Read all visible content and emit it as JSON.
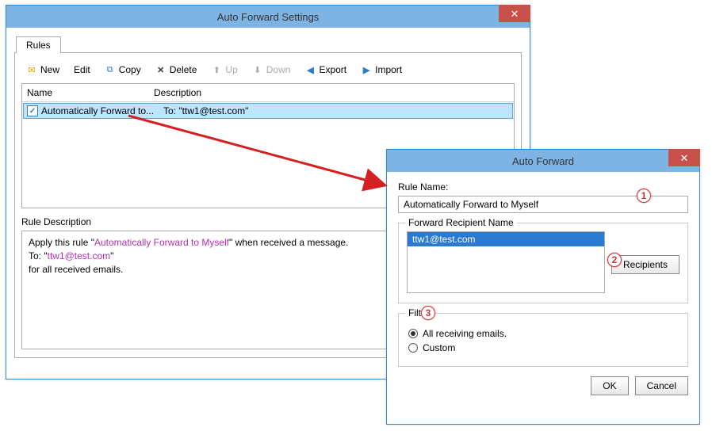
{
  "colors": {
    "accent": "#7eb4e3",
    "close": "#c8504b",
    "selection": "#bfe4ff",
    "highlight": "#2a7ad1",
    "link": "#b030b0"
  },
  "win1": {
    "title": "Auto Forward Settings",
    "tab": "Rules",
    "toolbar": {
      "new": "New",
      "edit": "Edit",
      "copy": "Copy",
      "delete": "Delete",
      "up": "Up",
      "down": "Down",
      "export": "Export",
      "import": "Import"
    },
    "cols": {
      "name": "Name",
      "desc": "Description"
    },
    "rule": {
      "name": "Automatically Forward to...",
      "desc": "To: \"ttw1@test.com\""
    },
    "descLabel": "Rule Description",
    "descText": {
      "l1a": "Apply this rule \"",
      "l1link": "Automatically Forward to Myself",
      "l1b": "\" when received a message.",
      "l2a": "To: \"",
      "l2link": "ttw1@test.com",
      "l2b": "\"",
      "l3": "for all received emails."
    }
  },
  "win2": {
    "title": "Auto Forward",
    "ruleNameLabel": "Rule Name:",
    "ruleNameValue": "Automatically Forward to Myself",
    "forwardGroup": "Forward Recipient Name",
    "recipient": "ttw1@test.com",
    "recipientsBtn": "Recipients",
    "filterGroup": "Filter",
    "optAll": "All receiving emails.",
    "optCustom": "Custom",
    "ok": "OK",
    "cancel": "Cancel"
  },
  "badges": {
    "b1": "1",
    "b2": "2",
    "b3": "3"
  }
}
